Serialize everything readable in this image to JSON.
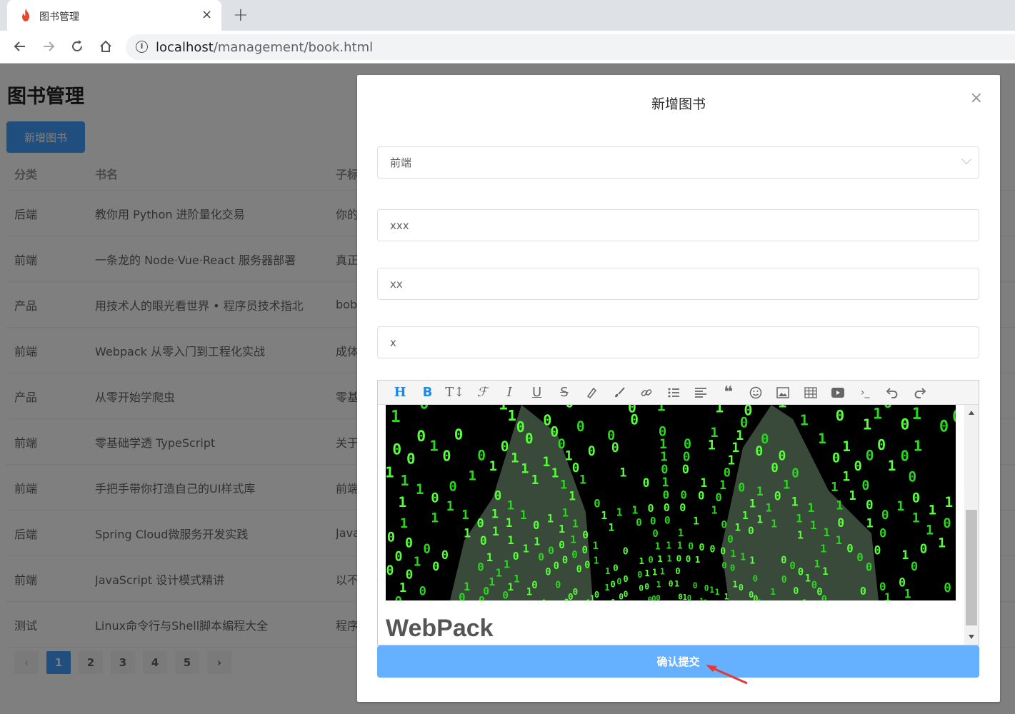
{
  "browser": {
    "tab_title": "图书管理",
    "tab_close": "×",
    "new_tab": "+",
    "url_host": "localhost",
    "url_path": "/management/book.html",
    "info": "i"
  },
  "page": {
    "title": "图书管理",
    "add_button": "新增图书",
    "columns": [
      "分类",
      "书名",
      "子标"
    ],
    "rows": [
      {
        "category": "后端",
        "name": "教你用 Python 进阶量化交易",
        "sub": "你的"
      },
      {
        "category": "前端",
        "name": "一条龙的 Node·Vue·React 服务器部署",
        "sub": "真正"
      },
      {
        "category": "产品",
        "name": "用技术人的眼光看世界 • 程序员技术指北",
        "sub": "bob"
      },
      {
        "category": "前端",
        "name": "Webpack 从零入门到工程化实战",
        "sub": "成体"
      },
      {
        "category": "产品",
        "name": "从零开始学爬虫",
        "sub": "零基"
      },
      {
        "category": "前端",
        "name": "零基础学透 TypeScript",
        "sub": "关于"
      },
      {
        "category": "前端",
        "name": "手把手带你打造自己的UI样式库",
        "sub": "前端"
      },
      {
        "category": "后端",
        "name": "Spring Cloud微服务开发实践",
        "sub": "Java"
      },
      {
        "category": "前端",
        "name": "JavaScript 设计模式精讲",
        "sub": "以不"
      },
      {
        "category": "测试",
        "name": "Linux命令行与Shell脚本编程大全",
        "sub": "程序"
      }
    ],
    "pagination": {
      "prev": "‹",
      "next": "›",
      "pages": [
        "1",
        "2",
        "3",
        "4",
        "5"
      ],
      "current": "1"
    }
  },
  "dialog": {
    "title": "新增图书",
    "close": "×",
    "category_value": "前端",
    "field1_value": "xxx",
    "field2_value": "xx",
    "field3_value": "x",
    "editor_heading": "WebPack",
    "submit_label": "确认提交"
  },
  "colors": {
    "primary": "#409eff",
    "submit": "#66b1ff",
    "arrow": "#e53935"
  }
}
